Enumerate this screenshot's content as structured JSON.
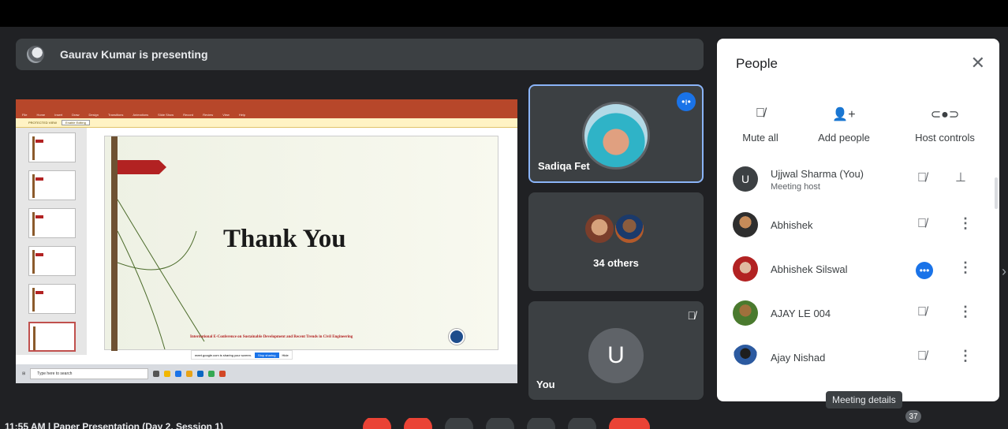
{
  "presenter": {
    "text": "Gaurav Kumar is presenting"
  },
  "slide": {
    "title": "Thank You",
    "footer": "International E-Conference on Sustainable Development and Recent Trends in Civil Engineering",
    "protected_view": "PROTECTED VIEW",
    "enable_editing": "Enable Editing",
    "share_notice": "meet.google.com is sharing your screen.",
    "stop_sharing": "Stop sharing",
    "hide": "Hide",
    "taskbar_search": "Type here to search",
    "ribbon": [
      "File",
      "Home",
      "Insert",
      "Draw",
      "Design",
      "Transitions",
      "Animations",
      "Slide Show",
      "Record",
      "Review",
      "View",
      "Help"
    ]
  },
  "tiles": {
    "sadiqa": "Sadiqa Fet",
    "others": "34 others",
    "you_initial": "U",
    "you": "You"
  },
  "people": {
    "title": "People",
    "controls": [
      "Mute all",
      "Add people",
      "Host controls"
    ],
    "rows": [
      {
        "name": "Ujjwal Sharma (You)",
        "sub": "Meeting host",
        "initial": "U"
      },
      {
        "name": "Abhishek"
      },
      {
        "name": "Abhishek Silswal"
      },
      {
        "name": "AJAY LE 004"
      },
      {
        "name": "Ajay Nishad"
      }
    ]
  },
  "tooltip": "Meeting details",
  "participant_count": "37",
  "bottom": {
    "text": "11:55 AM  |  Paper Presentation (Day 2, Session 1)"
  },
  "colors": {
    "accent": "#1a73e8",
    "end_call": "#ea4335",
    "tile_bg": "#3c4043"
  }
}
